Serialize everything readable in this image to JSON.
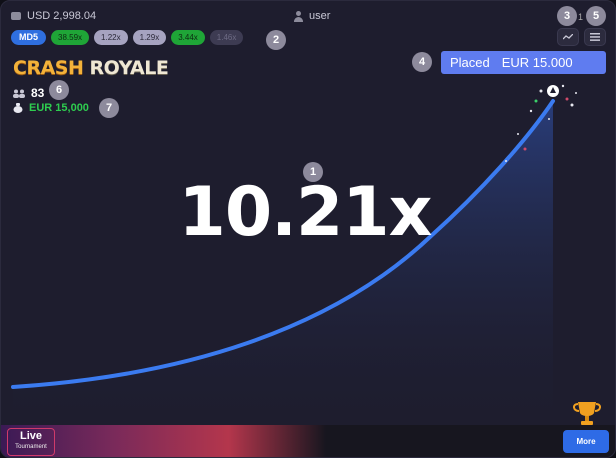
{
  "header": {
    "balance": "USD 2,998.04",
    "username": "user",
    "top_right_fragment": "1"
  },
  "history": {
    "md5_label": "MD5",
    "multipliers": [
      {
        "value": "38.59x",
        "tone": "green"
      },
      {
        "value": "1.22x",
        "tone": "gray"
      },
      {
        "value": "1.29x",
        "tone": "gray"
      },
      {
        "value": "3.44x",
        "tone": "green"
      },
      {
        "value": "1.46x",
        "tone": "dim"
      }
    ]
  },
  "game": {
    "title_part1": "CRASH",
    "title_part2": "ROYALE",
    "players_count": "83",
    "bank_amount": "EUR 15,000",
    "current_multiplier": "10.21x",
    "placed_label": "Placed",
    "placed_amount": "EUR 15.000"
  },
  "badges": {
    "b1": "1",
    "b2": "2",
    "b3": "3",
    "b4": "4",
    "b5": "5",
    "b6": "6",
    "b7": "7"
  },
  "footer": {
    "live_title": "Live",
    "live_subtitle": "Tournament",
    "more_label": "More"
  },
  "colors": {
    "background": "#1e1d2e",
    "curve": "#3b7bf0",
    "accent_blue": "#5f7cf0",
    "win_green": "#2ecc4f",
    "title_gold": "#f3b23a"
  },
  "icons": {
    "balance": "coin-stack-icon",
    "user": "user-icon",
    "chart": "chart-trend-icon",
    "menu": "hamburger-menu-icon",
    "players": "players-icon",
    "bank": "money-bag-icon",
    "trophy": "trophy-icon"
  }
}
